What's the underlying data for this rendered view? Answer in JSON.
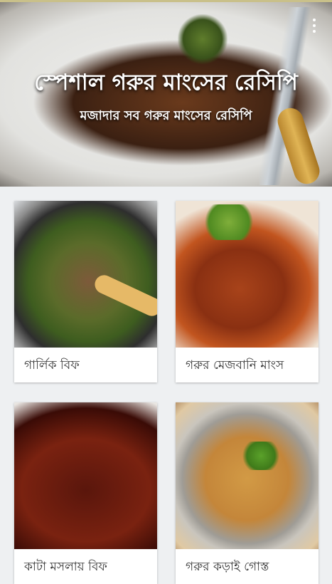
{
  "header": {
    "title": "স্পেশাল গরুর মাংসের রেসিপি",
    "subtitle": "মজাদার সব গরুর মাংসের রেসিপি",
    "menu_icon": "more-vert-icon"
  },
  "recipes": [
    {
      "name": "গার্লিক বিফ"
    },
    {
      "name": "গরুর মেজবানি মাংস"
    },
    {
      "name": "কাটা মসলায় বিফ"
    },
    {
      "name": "গরুর কড়াই গোস্ত"
    }
  ]
}
